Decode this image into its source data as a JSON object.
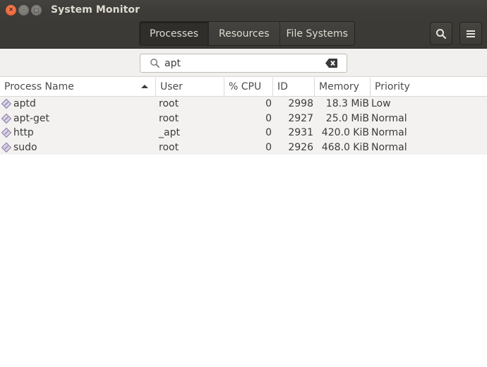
{
  "window": {
    "title": "System Monitor",
    "controls": {
      "close": "×",
      "minimize": "–",
      "maximize": "□"
    }
  },
  "tabs": [
    {
      "label": "Processes",
      "active": true
    },
    {
      "label": "Resources",
      "active": false
    },
    {
      "label": "File Systems",
      "active": false
    }
  ],
  "header_buttons": {
    "search": "search-icon",
    "menu": "hamburger-menu-icon"
  },
  "search": {
    "value": "apt",
    "placeholder": "",
    "icon": "search-icon",
    "clear_icon": "clear-backspace-icon"
  },
  "table": {
    "columns": [
      {
        "label": "Process Name",
        "sorted": "ascending"
      },
      {
        "label": "User"
      },
      {
        "label": "% CPU"
      },
      {
        "label": "ID"
      },
      {
        "label": "Memory"
      },
      {
        "label": "Priority"
      }
    ],
    "rows": [
      {
        "name": "aptd",
        "user": "root",
        "cpu": "0",
        "id": "2998",
        "memory": "18.3 MiB",
        "priority": "Low"
      },
      {
        "name": "apt-get",
        "user": "root",
        "cpu": "0",
        "id": "2927",
        "memory": "25.0 MiB",
        "priority": "Normal"
      },
      {
        "name": "http",
        "user": "_apt",
        "cpu": "0",
        "id": "2931",
        "memory": "420.0 KiB",
        "priority": "Normal"
      },
      {
        "name": "sudo",
        "user": "root",
        "cpu": "0",
        "id": "2926",
        "memory": "468.0 KiB",
        "priority": "Normal"
      }
    ]
  },
  "colors": {
    "headerbar": "#3c3b37",
    "close_button": "#e9541f",
    "title_text": "#dfdbd2",
    "row_background": "#f3f2f0",
    "process_icon": "#9b8ab8"
  }
}
